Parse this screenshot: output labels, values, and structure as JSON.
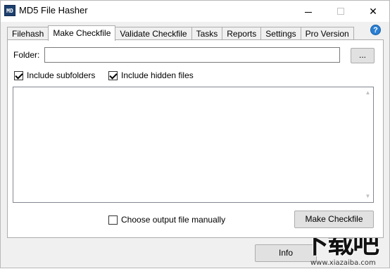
{
  "window": {
    "app_icon_text": "MD",
    "title": "MD5 File Hasher",
    "minimize_glyph": "—",
    "close_glyph": "✕"
  },
  "tabs": [
    {
      "label": "Filehash",
      "active": false
    },
    {
      "label": "Make Checkfile",
      "active": true
    },
    {
      "label": "Validate Checkfile",
      "active": false
    },
    {
      "label": "Tasks",
      "active": false
    },
    {
      "label": "Reports",
      "active": false
    },
    {
      "label": "Settings",
      "active": false
    },
    {
      "label": "Pro Version",
      "active": false
    }
  ],
  "help_icon": {
    "glyph": "?",
    "color": "#2a7fd4"
  },
  "make_checkfile": {
    "folder_label": "Folder:",
    "folder_value": "",
    "browse_label": "...",
    "include_subfolders": {
      "label": "Include subfolders",
      "checked": true
    },
    "include_hidden": {
      "label": "Include hidden files",
      "checked": true
    },
    "output_list": {
      "scroll_up": "▲",
      "scroll_down": "▼"
    },
    "choose_output": {
      "label": "Choose output file manually",
      "checked": false
    },
    "make_button": "Make Checkfile"
  },
  "footer": {
    "info_button": "Info"
  },
  "watermark": {
    "text": "下载吧",
    "url": "www.xiazaiba.com"
  }
}
